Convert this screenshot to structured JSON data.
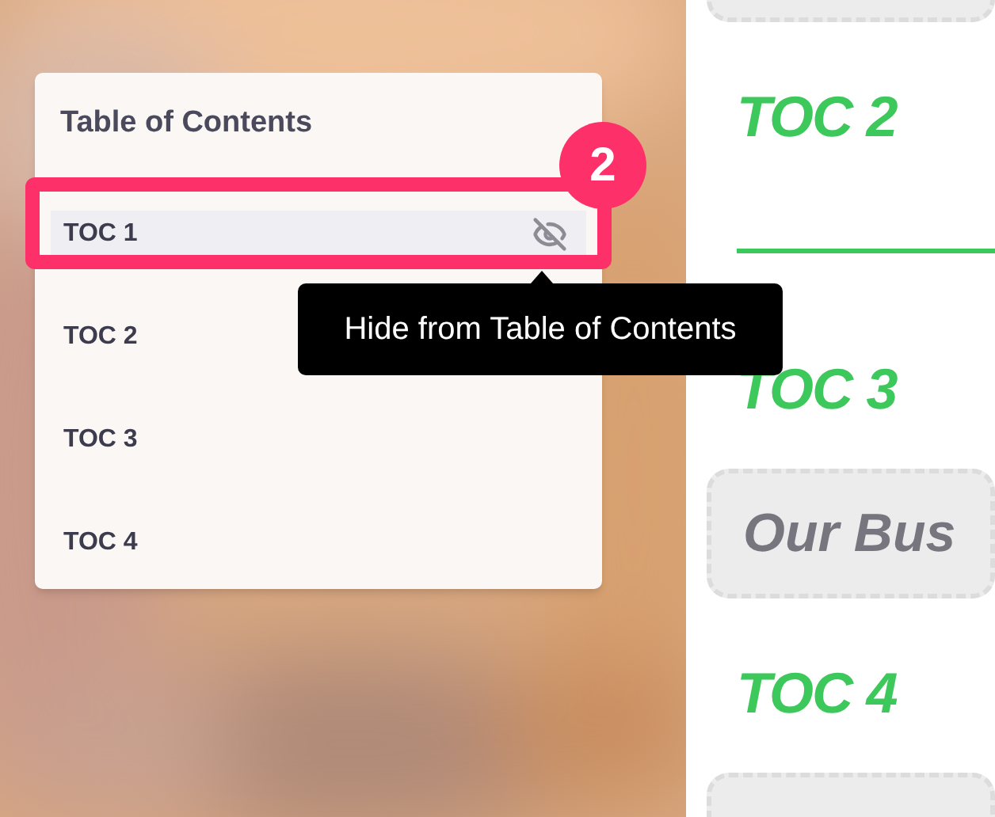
{
  "toc_panel": {
    "title": "Table of Contents",
    "items": [
      {
        "label": "TOC 1",
        "selected": true
      },
      {
        "label": "TOC 2",
        "selected": false
      },
      {
        "label": "TOC 3",
        "selected": false
      },
      {
        "label": "TOC 4",
        "selected": false
      }
    ]
  },
  "callout": {
    "number": "2"
  },
  "tooltip": {
    "text": "Hide from Table of Contents"
  },
  "document": {
    "blocks": [
      {
        "kind": "box"
      },
      {
        "kind": "heading",
        "text": "TOC 2"
      },
      {
        "kind": "rule"
      },
      {
        "kind": "heading",
        "text": "TOC 3"
      },
      {
        "kind": "box",
        "text": "Our Bus"
      },
      {
        "kind": "heading",
        "text": "TOC 4"
      },
      {
        "kind": "box"
      }
    ]
  }
}
